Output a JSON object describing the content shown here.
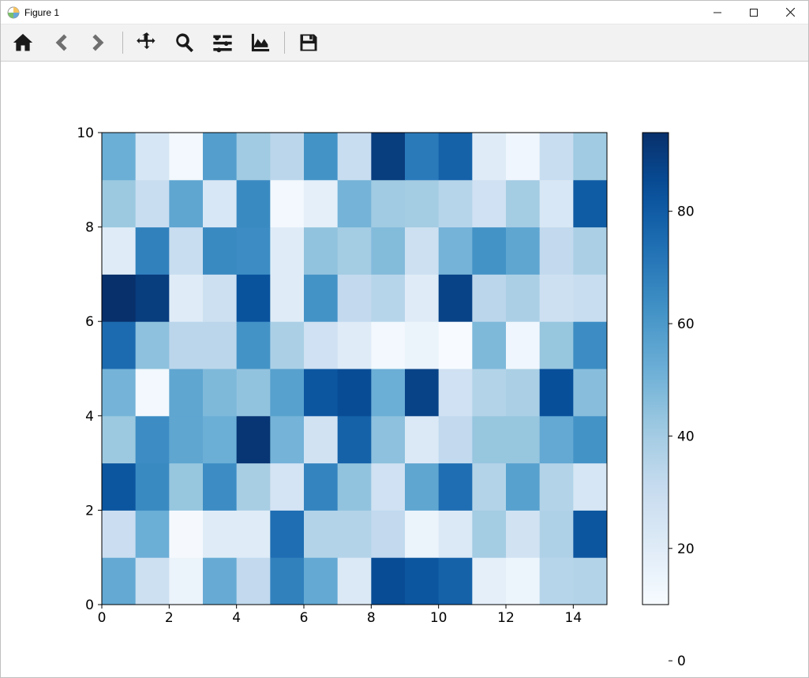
{
  "window": {
    "title": "Figure 1"
  },
  "toolbar": {
    "home": "Home",
    "back": "Back",
    "forward": "Forward",
    "pan": "Pan",
    "zoom": "Zoom",
    "subplots": "Configure subplots",
    "edit": "Edit axis",
    "save": "Save"
  },
  "chart_data": {
    "type": "heatmap",
    "xlabel": "",
    "ylabel": "",
    "title": "",
    "xlim": [
      0,
      15
    ],
    "ylim": [
      0,
      10
    ],
    "x_ticks": [
      0,
      2,
      4,
      6,
      8,
      10,
      12,
      14
    ],
    "y_ticks": [
      0,
      2,
      4,
      6,
      8,
      10
    ],
    "colorbar": {
      "ticks": [
        0,
        20,
        40,
        60,
        80
      ],
      "min": 0,
      "max": 96,
      "cmap": "Blues"
    },
    "grid": [
      [
        54,
        28,
        15,
        53,
        32,
        68,
        54,
        22,
        85,
        82,
        78,
        18,
        14,
        35,
        36
      ],
      [
        29,
        52,
        11,
        20,
        20,
        74,
        36,
        36,
        32,
        15,
        22,
        40,
        26,
        37,
        82
      ],
      [
        82,
        65,
        43,
        64,
        39,
        25,
        67,
        44,
        27,
        55,
        74,
        36,
        57,
        36,
        24
      ],
      [
        42,
        64,
        55,
        52,
        92,
        50,
        26,
        78,
        45,
        22,
        32,
        43,
        43,
        54,
        62
      ],
      [
        50,
        12,
        55,
        48,
        44,
        57,
        82,
        85,
        52,
        88,
        27,
        36,
        38,
        84,
        46
      ],
      [
        75,
        45,
        34,
        34,
        62,
        38,
        27,
        20,
        12,
        15,
        10,
        48,
        13,
        43,
        64
      ],
      [
        94,
        90,
        20,
        28,
        83,
        20,
        62,
        32,
        35,
        20,
        88,
        34,
        38,
        28,
        30
      ],
      [
        20,
        68,
        30,
        65,
        64,
        20,
        44,
        40,
        47,
        28,
        50,
        62,
        55,
        32,
        38
      ],
      [
        42,
        30,
        55,
        23,
        65,
        12,
        18,
        50,
        41,
        40,
        35,
        27,
        40,
        23,
        80
      ],
      [
        52,
        24,
        12,
        58,
        41,
        34,
        62,
        30,
        90,
        70,
        78,
        20,
        13,
        30,
        41
      ]
    ]
  }
}
